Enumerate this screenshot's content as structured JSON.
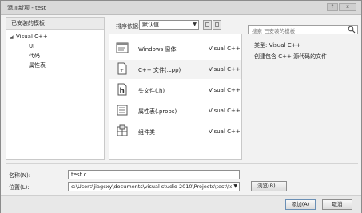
{
  "window": {
    "title": "添加新项 - test",
    "controls": [
      "?",
      "x"
    ]
  },
  "left_panel": {
    "header": "已安装的模板",
    "tree": [
      {
        "label": "Visual C++",
        "expanded": true
      },
      {
        "label": "UI"
      },
      {
        "label": "代码"
      },
      {
        "label": "属性表"
      }
    ]
  },
  "toolbar": {
    "sort_label": "排序依据:",
    "sort_value": "默认值"
  },
  "templates": [
    {
      "name": "Windows 窗体",
      "lang": "Visual C++",
      "icon": "windows-form-icon"
    },
    {
      "name": "C++ 文件(.cpp)",
      "lang": "Visual C++",
      "icon": "cpp-file-icon",
      "selected": true
    },
    {
      "name": "头文件(.h)",
      "lang": "Visual C++",
      "icon": "header-file-icon"
    },
    {
      "name": "属性表(.props)",
      "lang": "Visual C++",
      "icon": "property-sheet-icon"
    },
    {
      "name": "组件类",
      "lang": "Visual C++",
      "icon": "component-class-icon"
    }
  ],
  "search": {
    "placeholder": "搜索 已安装的模板"
  },
  "details": {
    "type_line": "类型: Visual C++",
    "description": "创建包含 C++ 源代码的文件"
  },
  "form": {
    "name_label": "名称(N):",
    "name_value": "test.c",
    "location_label": "位置(L):",
    "location_value": "c:\\Users\\jiagcxy\\documents\\visual studio 2010\\Projects\\test\\te",
    "browse_label": "浏览(B)..."
  },
  "buttons": {
    "add": "添加(A)",
    "cancel": "取消"
  },
  "colors": {
    "accent": "#6a8fb5",
    "title_bg": "#d9d9d9"
  }
}
